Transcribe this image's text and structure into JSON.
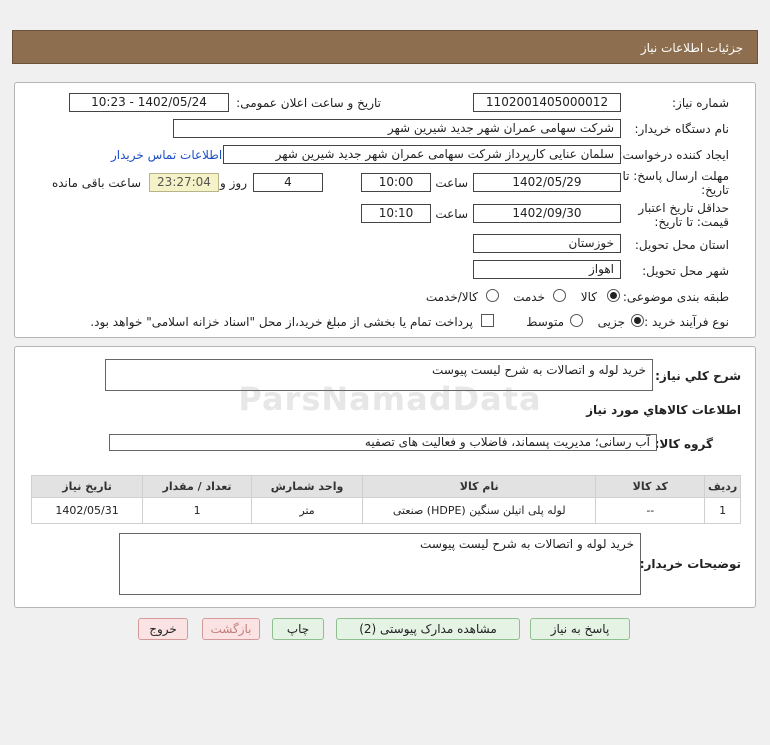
{
  "header": {
    "title": "جزئیات اطلاعات نیاز"
  },
  "form": {
    "need_number_label": "شماره نیاز:",
    "need_number": "1102001405000012",
    "announce_label": "تاریخ و ساعت اعلان عمومی:",
    "announce_value": "1402/05/24 - 10:23",
    "buyer_org_label": "نام دستگاه خریدار:",
    "buyer_org": "شرکت سهامی عمران شهر جدید شیرین شهر",
    "creator_label": "ایجاد کننده درخواست:",
    "creator": "سلمان عنایی کارپرداز شرکت سهامی عمران شهر جدید شیرین شهر",
    "contact_link": "اطلاعات تماس خریدار",
    "deadline_label_1": "مهلت ارسال پاسخ: تا",
    "deadline_label_2": "تاریخ:",
    "deadline_date": "1402/05/29",
    "time_label": "ساعت",
    "deadline_time": "10:00",
    "days_value": "4",
    "days_label": "روز و",
    "remaining_time": "23:27:04",
    "remaining_label": "ساعت باقی مانده",
    "validity_label_1": "حداقل تاریخ اعتبار",
    "validity_label_2": "قیمت: تا تاریخ:",
    "validity_date": "1402/09/30",
    "validity_time_label": "ساعت",
    "validity_time": "10:10",
    "province_label": "استان محل تحویل:",
    "province": "خوزستان",
    "city_label": "شهر محل تحویل:",
    "city": "اهواز",
    "category_label": "طبقه بندی موضوعی:",
    "category_options": [
      "کالا",
      "خدمت",
      "کالا/خدمت"
    ],
    "process_label": "نوع فرآیند خرید :",
    "process_options": [
      "جزیی",
      "متوسط"
    ],
    "payment_note": "پرداخت تمام یا بخشی از مبلغ خرید،از محل \"اسناد خزانه اسلامی\" خواهد بود."
  },
  "details": {
    "description_label": "شرح کلي نياز:",
    "description": "خرید لوله و اتصالات به شرح لیست پیوست",
    "goods_info_title": "اطلاعات کالاهاي مورد نياز",
    "goods_group_label": "گروه کالا:",
    "goods_group": "آب رسانی؛ مدیریت پسماند، فاضلاب و فعالیت های تصفیه",
    "table": {
      "headers": [
        "ردیف",
        "کد کالا",
        "نام کالا",
        "واحد شمارش",
        "تعداد / مقدار",
        "تاریخ نیاز"
      ],
      "rows": [
        [
          "1",
          "--",
          "لوله پلی اتیلن سنگین (HDPE) صنعتی",
          "متر",
          "1",
          "1402/05/31"
        ]
      ]
    },
    "buyer_notes_label": "توضیحات خریدار:",
    "buyer_notes": "خرید لوله و اتصالات به شرح لیست پیوست"
  },
  "buttons": {
    "reply": "پاسخ به نیاز",
    "attachments": "مشاهده مدارک پیوستی (2)",
    "print": "چاپ",
    "back": "بازگشت",
    "exit": "خروج"
  },
  "watermark": {
    "text": "ParsNamadData"
  }
}
